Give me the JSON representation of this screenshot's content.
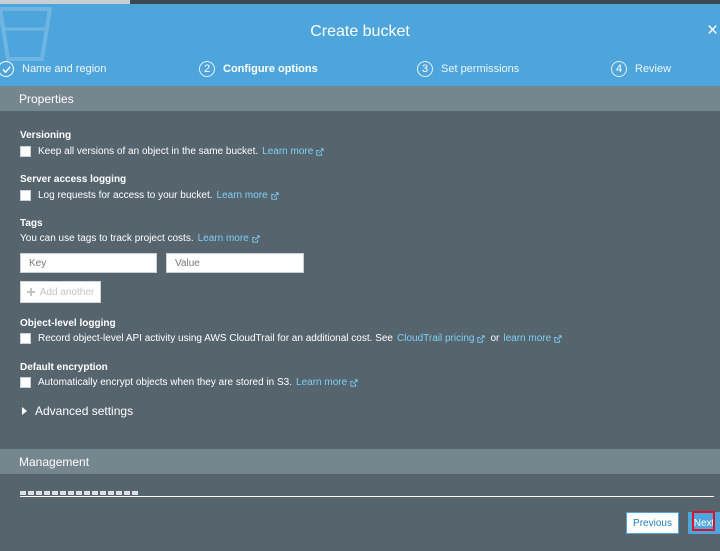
{
  "modal": {
    "title": "Create bucket",
    "close_glyph": "×"
  },
  "steps": [
    {
      "num": "✓",
      "label": "Name and region",
      "state": "done"
    },
    {
      "num": "2",
      "label": "Configure options",
      "state": "active"
    },
    {
      "num": "3",
      "label": "Set permissions",
      "state": "pending"
    },
    {
      "num": "4",
      "label": "Review",
      "state": "pending"
    }
  ],
  "properties": {
    "header": "Properties",
    "versioning": {
      "title": "Versioning",
      "text": "Keep all versions of an object in the same bucket.",
      "link": "Learn more",
      "checked": false
    },
    "logging": {
      "title": "Server access logging",
      "text": "Log requests for access to your bucket.",
      "link": "Learn more",
      "checked": false
    },
    "tags": {
      "title": "Tags",
      "text": "You can use tags to track project costs.",
      "link": "Learn more",
      "key_placeholder": "Key",
      "value_placeholder": "Value",
      "add_label": "Add another"
    },
    "object_logging": {
      "title": "Object-level logging",
      "text": "Record object-level API activity using AWS CloudTrail for an additional cost. See",
      "link1": "CloudTrail pricing",
      "or_text": "or",
      "link2": "learn more",
      "checked": false
    },
    "encryption": {
      "title": "Default encryption",
      "text": "Automatically encrypt objects when they are stored in S3.",
      "link": "Learn more",
      "checked": false
    },
    "advanced": "Advanced settings"
  },
  "management": {
    "header": "Management"
  },
  "footer": {
    "previous": "Previous",
    "next": "Next"
  },
  "colors": {
    "header_blue": "#4ea5dc",
    "panel_bg": "#56646e",
    "section_bar": "#76868f",
    "link": "#7ed0f6",
    "highlight": "#e0102a"
  },
  "icons": {
    "step_done": "check-circle-icon",
    "external_link": "external-link-icon",
    "advanced_toggle": "caret-right-icon",
    "add": "plus-icon",
    "close": "close-icon"
  }
}
